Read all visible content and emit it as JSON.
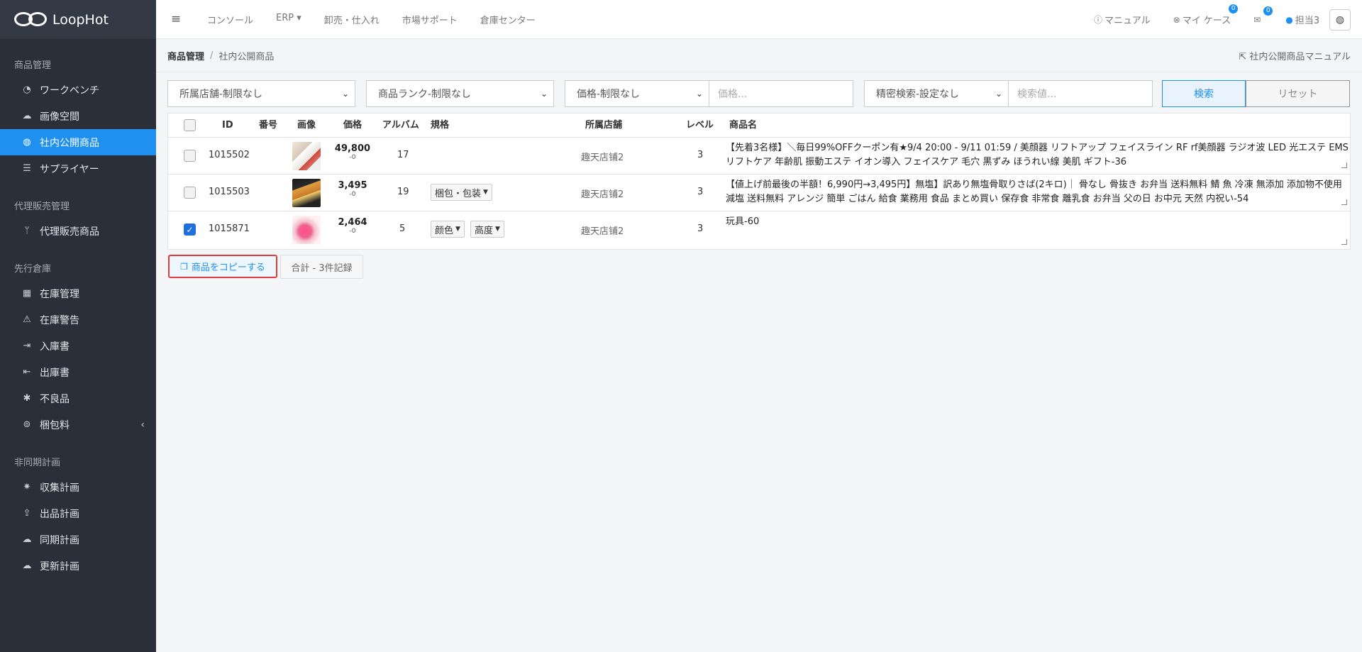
{
  "app": {
    "logo_text": "LoopHot"
  },
  "sidebar": {
    "groups": [
      {
        "label": "商品管理",
        "items": [
          {
            "label": "ワークベンチ",
            "icon": "dashboard-icon"
          },
          {
            "label": "画像空間",
            "icon": "cloud-icon"
          },
          {
            "label": "社内公開商品",
            "icon": "globe-icon",
            "active": true
          },
          {
            "label": "サプライヤー",
            "icon": "list-icon"
          }
        ]
      },
      {
        "label": "代理販売管理",
        "items": [
          {
            "label": "代理販売商品",
            "icon": "branch-icon"
          }
        ]
      },
      {
        "label": "先行倉庫",
        "items": [
          {
            "label": "在庫管理",
            "icon": "boxes-icon"
          },
          {
            "label": "在庫警告",
            "icon": "warning-icon"
          },
          {
            "label": "入庫書",
            "icon": "sign-in-icon"
          },
          {
            "label": "出庫書",
            "icon": "sign-out-icon"
          },
          {
            "label": "不良品",
            "icon": "bug-icon"
          },
          {
            "label": "梱包料",
            "icon": "search-dollar-icon",
            "chevron": "‹"
          }
        ]
      },
      {
        "label": "非同期計画",
        "items": [
          {
            "label": "収集計画",
            "icon": "spider-icon"
          },
          {
            "label": "出品計画",
            "icon": "upload-icon"
          },
          {
            "label": "同期計画",
            "icon": "cloud-sync-icon"
          },
          {
            "label": "更新計画",
            "icon": "cloud-upload-icon"
          }
        ]
      }
    ]
  },
  "topbar": {
    "nav": [
      "コンソール",
      "ERP ▾",
      "卸売・仕入れ",
      "市場サポート",
      "倉庫センター"
    ],
    "manual": "マニュアル",
    "my_case": "マイ ケース",
    "my_case_badge": "0",
    "mail_badge": "0",
    "user": "担当3"
  },
  "breadcrumb": {
    "parent": "商品管理",
    "separator": "/",
    "current": "社内公開商品",
    "manual_link": "社内公開商品マニュアル"
  },
  "filters": {
    "store": "所属店舗-制限なし",
    "rank": "商品ランク-制限なし",
    "price_select": "価格-制限なし",
    "price_placeholder": "価格...",
    "advanced": "精密検索-設定なし",
    "search_placeholder": "検索値...",
    "search_button": "検索",
    "reset_button": "リセット"
  },
  "table": {
    "headers": {
      "id": "ID",
      "number": "番号",
      "image": "画像",
      "price": "価格",
      "album": "アルバム",
      "spec": "規格",
      "store": "所属店舗",
      "level": "レベル",
      "name": "商品名"
    },
    "rows": [
      {
        "id": "1015502",
        "price": "49,800",
        "price_sub": "-0",
        "album": "17",
        "specs": [],
        "store": "趣天店铺2",
        "level": "3",
        "name": "【先着3名様】＼毎日99%OFFクーポン有★9/4 20:00 - 9/11 01:59 / 美顔器 リフトアップ フェイスライン RF rf美顔器 ラジオ波 LED 光エステ EMS リフトケア 年齢肌 振動エステ イオン導入 フェイスケア 毛穴 黒ずみ ほうれい線 美肌 ギフト-36",
        "checked": false
      },
      {
        "id": "1015503",
        "price": "3,495",
        "price_sub": "-0",
        "album": "19",
        "specs": [
          "梱包・包装"
        ],
        "store": "趣天店铺2",
        "level": "3",
        "name": "【値上げ前最後の半額！6,990円→3,495円】無塩】訳あり無塩骨取りさば(2キロ)｜ 骨なし 骨抜き お弁当 送料無料 鯖 魚 冷凍 無添加 添加物不使用 減塩 送料無料 アレンジ 簡単 ごはん 給食 業務用 食品 まとめ買い 保存食 非常食 離乳食 お弁当 父の日 お中元 天然 内祝い-54",
        "checked": false
      },
      {
        "id": "1015871",
        "price": "2,464",
        "price_sub": "-0",
        "album": "5",
        "specs": [
          "颜色",
          "高度"
        ],
        "store": "趣天店铺2",
        "level": "3",
        "name": "玩具-60",
        "checked": true
      }
    ]
  },
  "actions": {
    "copy_button": "商品をコピーする",
    "total": "合計 - 3件記録"
  }
}
